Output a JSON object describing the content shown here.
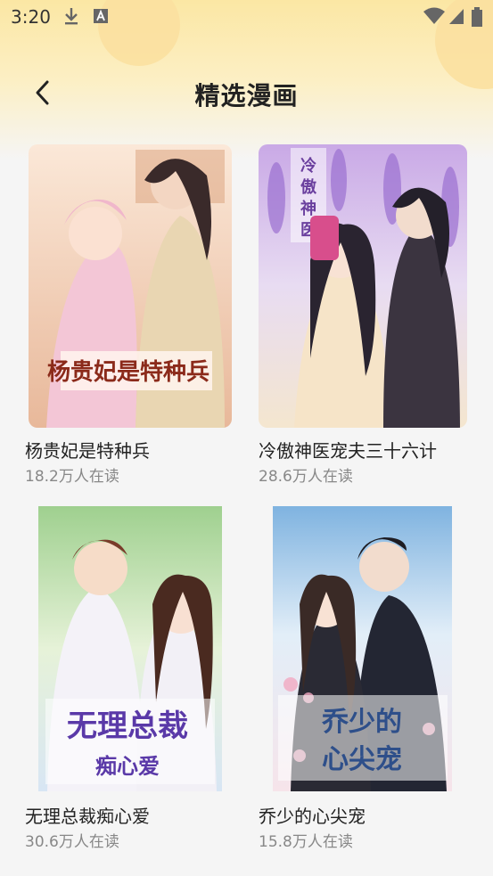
{
  "status_bar": {
    "time": "3:20",
    "left_icons": [
      "download-icon",
      "app-notification-icon"
    ],
    "right_icons": [
      "wifi-icon",
      "signal-icon",
      "battery-icon"
    ]
  },
  "header": {
    "back_icon": "chevron-left-icon",
    "title": "精选漫画"
  },
  "comics": [
    {
      "title": "杨贵妃是特种兵",
      "readers": "18.2万人在读",
      "cover_lettering": "杨贵妃是特种兵",
      "colors": {
        "bg": "#f6dcc8",
        "accent": "#8b2a1a"
      }
    },
    {
      "title": "冷傲神医宠夫三十六计",
      "readers": "28.6万人在读",
      "cover_lettering": "冷傲神医宠夫三十六计",
      "colors": {
        "bg": "#cdb8e6",
        "accent": "#6a3f9e"
      }
    },
    {
      "title": "无理总裁痴心爱",
      "readers": "30.6万人在读",
      "cover_lettering": "无理总裁痴心爱",
      "colors": {
        "bg": "#bfe0c4",
        "accent": "#5a39a8"
      }
    },
    {
      "title": "乔少的心尖宠",
      "readers": "15.8万人在读",
      "cover_lettering": "乔少的心尖宠",
      "colors": {
        "bg": "#cfe2f2",
        "accent": "#2e4f8a"
      }
    }
  ]
}
